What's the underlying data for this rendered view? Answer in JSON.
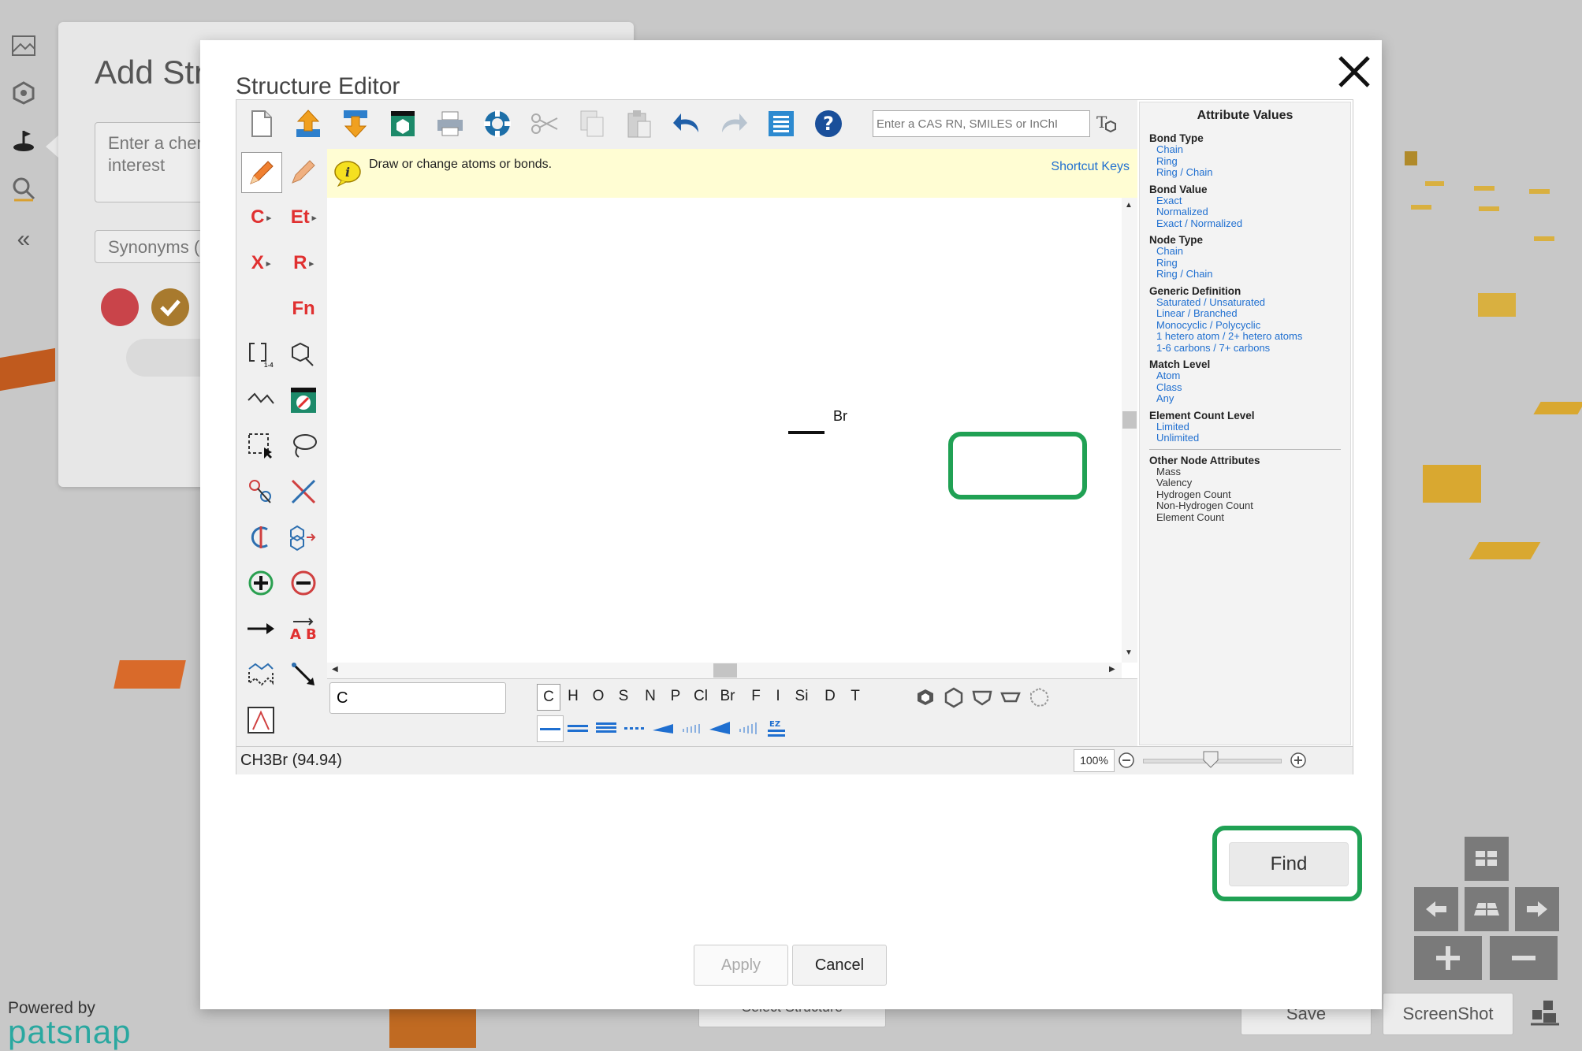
{
  "background": {
    "panel_title": "Add Str",
    "input_placeholder": "Enter a chem interest",
    "synonyms_label": "Synonyms (c",
    "hidden_button": "Select Structure",
    "save_label": "Save",
    "screenshot_label": "ScreenShot",
    "powered_by": "Powered by",
    "brand": "patsnap"
  },
  "modal": {
    "title": "Structure Editor",
    "search_placeholder": "Enter a CAS RN, SMILES or InChI",
    "hint_text": "Draw or change atoms or bonds.",
    "shortcut_keys": "Shortcut Keys",
    "molecule_label": "Br",
    "atom_input_value": "C",
    "atoms": [
      "C",
      "H",
      "O",
      "S",
      "N",
      "P",
      "Cl",
      "Br",
      "F",
      "I",
      "Si",
      "D",
      "T"
    ],
    "formula": "CH3Br (94.94)",
    "zoom": "100%",
    "find_label": "Find",
    "apply_label": "Apply",
    "cancel_label": "Cancel",
    "tools": {
      "carbon": "C",
      "ethyl": "Et",
      "halogen": "X",
      "rgroup": "R",
      "function": "Fn"
    }
  },
  "attributes": {
    "title": "Attribute Values",
    "groups": [
      {
        "heading": "Bond Type",
        "items": [
          "Chain",
          "Ring",
          "Ring / Chain"
        ]
      },
      {
        "heading": "Bond Value",
        "items": [
          "Exact",
          "Normalized",
          "Exact / Normalized"
        ]
      },
      {
        "heading": "Node Type",
        "items": [
          "Chain",
          "Ring",
          "Ring / Chain"
        ]
      },
      {
        "heading": "Generic Definition",
        "items": [
          "Saturated / Unsaturated",
          "Linear / Branched",
          "Monocyclic / Polycyclic",
          "1 hetero atom / 2+ hetero atoms",
          "1-6 carbons / 7+ carbons"
        ]
      },
      {
        "heading": "Match Level",
        "items": [
          "Atom",
          "Class",
          "Any"
        ]
      },
      {
        "heading": "Element Count Level",
        "items": [
          "Limited",
          "Unlimited"
        ]
      }
    ],
    "other_heading": "Other Node Attributes",
    "other_items": [
      "Mass",
      "Valency",
      "Hydrogen Count",
      "Non-Hydrogen Count",
      "Element Count"
    ]
  },
  "colors": {
    "highlight": "#20a154",
    "link": "#1f6fd0",
    "tool_red": "#e03030"
  }
}
